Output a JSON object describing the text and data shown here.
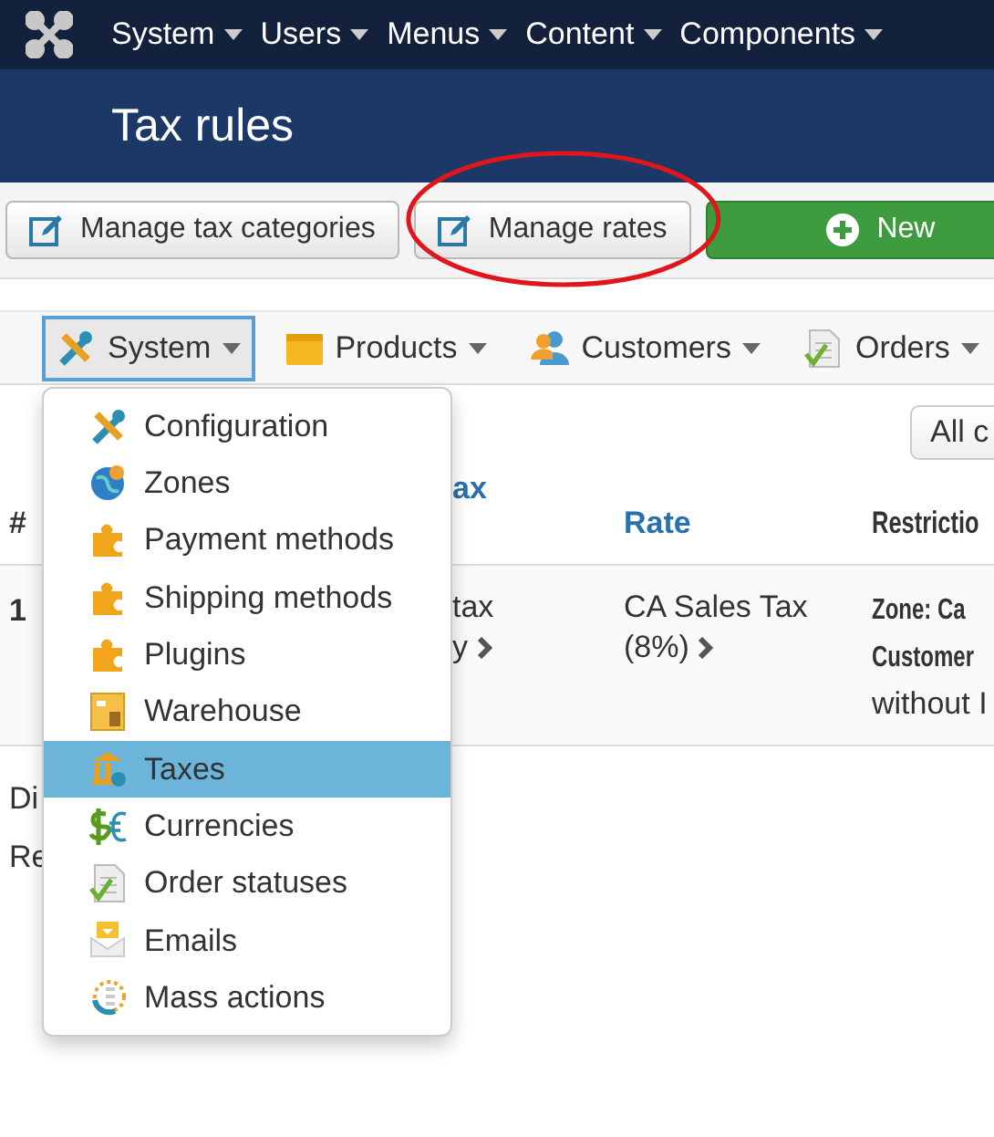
{
  "top_menu": {
    "items": [
      "System",
      "Users",
      "Menus",
      "Content",
      "Components"
    ]
  },
  "page_title": "Tax rules",
  "toolbar": {
    "buttons": [
      {
        "label": "Manage tax categories",
        "kind": "edit",
        "circled": false
      },
      {
        "label": "Manage rates",
        "kind": "edit",
        "circled": true
      },
      {
        "label": "New",
        "kind": "new",
        "circled": false
      }
    ]
  },
  "component_menu": {
    "items": [
      {
        "label": "System",
        "expanded": true
      },
      {
        "label": "Products",
        "expanded": false
      },
      {
        "label": "Customers",
        "expanded": false
      },
      {
        "label": "Orders",
        "expanded": false
      }
    ]
  },
  "dropdown": {
    "items": [
      {
        "label": "Configuration",
        "selected": false
      },
      {
        "label": "Zones",
        "selected": false
      },
      {
        "label": "Payment methods",
        "selected": false
      },
      {
        "label": "Shipping methods",
        "selected": false
      },
      {
        "label": "Plugins",
        "selected": false
      },
      {
        "label": "Warehouse",
        "selected": false
      },
      {
        "label": "Taxes",
        "selected": true
      },
      {
        "label": "Currencies",
        "selected": false
      },
      {
        "label": "Order statuses",
        "selected": false
      },
      {
        "label": "Emails",
        "selected": false
      },
      {
        "label": "Mass actions",
        "selected": false
      }
    ]
  },
  "filter_button": "All c",
  "table": {
    "columns": [
      "#",
      "ax",
      "Rate",
      "Restrictio"
    ],
    "rows": [
      {
        "number": "1",
        "column_2": [
          "tax",
          "y"
        ],
        "rate": [
          "CA Sales Tax",
          "(8%)"
        ],
        "restrictions": [
          {
            "text": "Zone: Ca",
            "kind": "label"
          },
          {
            "text": "Customer",
            "kind": "label"
          },
          {
            "text": "without I",
            "kind": "value"
          }
        ]
      }
    ]
  },
  "below_table": [
    "Di",
    "Re"
  ]
}
